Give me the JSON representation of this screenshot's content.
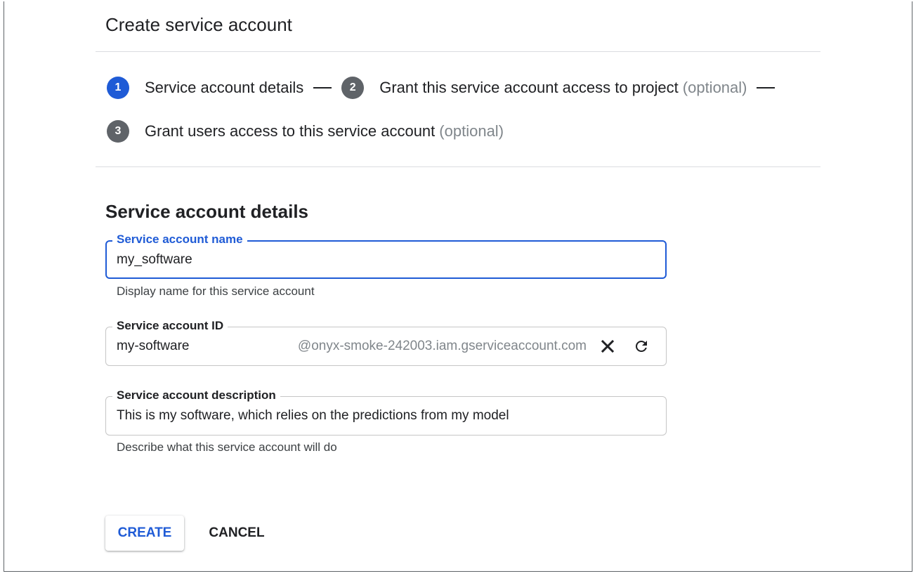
{
  "page": {
    "title": "Create service account"
  },
  "stepper": {
    "steps": [
      {
        "number": "1",
        "label": "Service account details",
        "optional": "",
        "state": "active"
      },
      {
        "number": "2",
        "label": "Grant this service account access to project",
        "optional": "(optional)",
        "state": "inactive"
      },
      {
        "number": "3",
        "label": "Grant users access to this service account",
        "optional": "(optional)",
        "state": "inactive"
      }
    ]
  },
  "form": {
    "section_title": "Service account details",
    "name_field": {
      "label": "Service account name",
      "value": "my_software",
      "helper": "Display name for this service account"
    },
    "id_field": {
      "label": "Service account ID",
      "value": "my-software",
      "suffix": "@onyx-smoke-242003.iam.gserviceaccount.com",
      "clear_icon": "close-icon",
      "refresh_icon": "refresh-icon"
    },
    "description_field": {
      "label": "Service account description",
      "value": "This is my software, which relies on the predictions from my model",
      "helper": "Describe what this service account will do"
    }
  },
  "actions": {
    "create_label": "CREATE",
    "cancel_label": "CANCEL"
  },
  "colors": {
    "accent": "#1f5bd6",
    "inactive_step": "#5f6368",
    "optional_text": "#80868b"
  }
}
